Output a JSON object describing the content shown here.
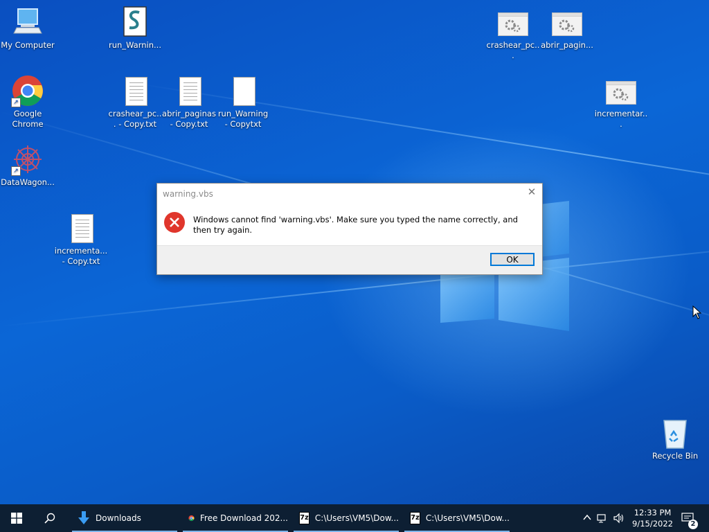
{
  "desktop": {
    "icons": {
      "my_computer": "My Computer",
      "google_chrome": "Google Chrome",
      "datawagon": "DataWagon...",
      "run_warning_script": "run_Warnin...",
      "crashear_copy": "crashear_pc... - Copy.txt",
      "abrir_copy": "abrir_paginas - Copy.txt",
      "run_warning_copy": "run_Warning - Copytxt",
      "incrementa_copy": "incrementa... - Copy.txt",
      "crashear_exe": "crashear_pc...",
      "abrir_exe": "abrir_pagin...",
      "incrementar_exe": "incrementar...",
      "recycle_bin": "Recycle Bin"
    }
  },
  "dialog": {
    "title": "warning.vbs",
    "close_glyph": "✕",
    "message": "Windows cannot find 'warning.vbs'. Make sure you typed the name correctly, and then try again.",
    "ok_label": "OK"
  },
  "taskbar": {
    "items": [
      {
        "label": "Downloads",
        "icon": "folder-download-icon"
      },
      {
        "label": "Free Download 202...",
        "icon": "chrome-icon"
      },
      {
        "label": "C:\\Users\\VM5\\Dow...",
        "icon": "7zip-icon"
      },
      {
        "label": "C:\\Users\\VM5\\Dow...",
        "icon": "7zip-icon"
      }
    ],
    "clock": {
      "time": "12:33 PM",
      "date": "9/15/2022"
    },
    "notifications_count": "2",
    "sevenzip_glyph": "7z"
  },
  "colors": {
    "taskbar_bg": "#0d1f33",
    "accent": "#0078d7",
    "error_red": "#e0362c"
  }
}
